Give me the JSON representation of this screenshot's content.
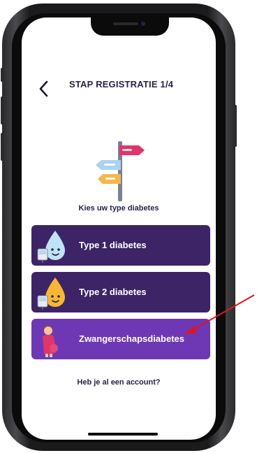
{
  "header": {
    "title": "STAP REGISTRATIE 1/4",
    "back_icon": "chevron-left-icon"
  },
  "illustration": {
    "icon": "signpost-icon",
    "colors": [
      "#e0356a",
      "#a9d3f0",
      "#f3b84b"
    ]
  },
  "prompt": "Kies uw type diabetes",
  "options": [
    {
      "label": "Type 1 diabetes",
      "icon": "blue-drop-with-meter-icon",
      "color": "#3d2466"
    },
    {
      "label": "Type 2 diabetes",
      "icon": "orange-drop-with-meter-icon",
      "color": "#3d2466"
    },
    {
      "label": "Zwangerschapsdiabetes",
      "icon": "pregnant-woman-icon",
      "color": "#6e38b4"
    }
  ],
  "account_link": "Heb je al een account?",
  "annotation": {
    "icon": "red-arrow-pointer",
    "color": "#e0141e"
  }
}
